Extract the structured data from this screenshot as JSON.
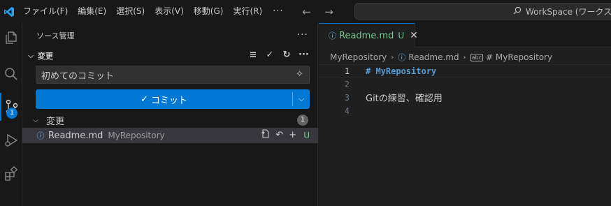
{
  "menu": [
    "ファイル(F)",
    "編集(E)",
    "選択(S)",
    "表示(V)",
    "移動(G)",
    "実行(R)"
  ],
  "menu_more": "···",
  "command_center": {
    "text": "WorkSpace (ワークスペース)"
  },
  "activity": {
    "scm_badge": "1"
  },
  "sidebar": {
    "title": "ソース管理",
    "section_title": "変更",
    "commit_message": "初めてのコミット",
    "commit_button": "コミット",
    "changes_label": "変更",
    "changes_count": "1",
    "file": {
      "name": "Readme.md",
      "path": "MyRepository",
      "status": "U"
    }
  },
  "editor": {
    "tab": {
      "name": "Readme.md",
      "status": "U"
    },
    "breadcrumb": [
      "MyRepository",
      "Readme.md",
      "# MyRepository"
    ],
    "lines": [
      {
        "num": "1",
        "text": "# MyRepository",
        "style": "heading"
      },
      {
        "num": "2",
        "text": "",
        "style": "plain"
      },
      {
        "num": "3",
        "text": "Gitの練習、確認用",
        "style": "plain"
      },
      {
        "num": "4",
        "text": "",
        "style": "plain"
      }
    ]
  },
  "colors": {
    "accent": "#0078d4",
    "untracked": "#73c991",
    "info": "#75beff"
  }
}
